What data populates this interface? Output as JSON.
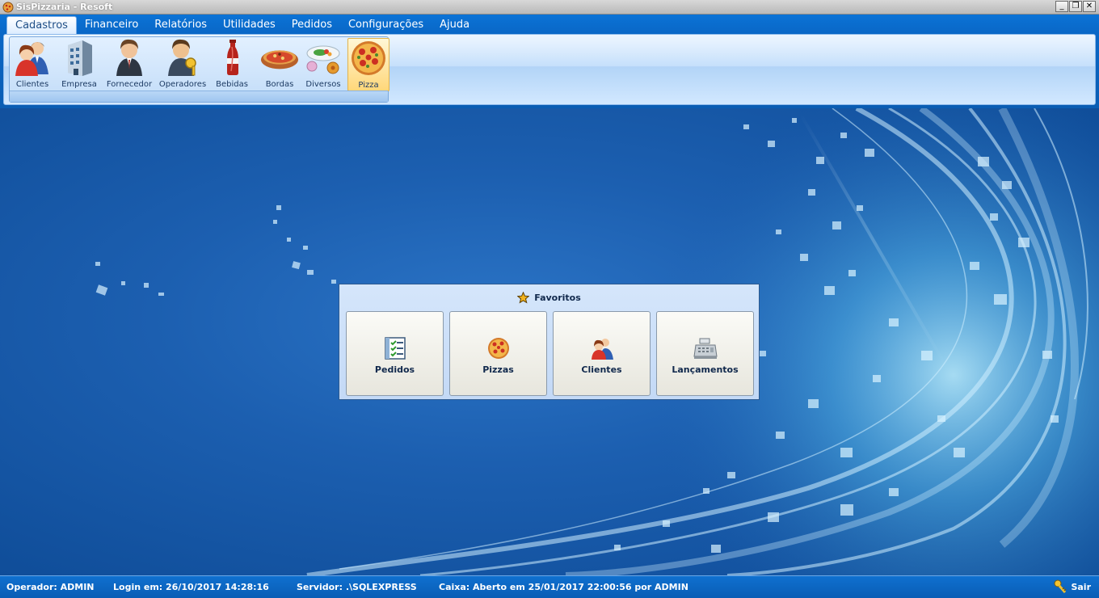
{
  "window": {
    "title": "SisPizzaria - Resoft",
    "minimize_glyph": "_",
    "restore_glyph": "❐",
    "close_glyph": "✕"
  },
  "menu": {
    "tabs": [
      "Cadastros",
      "Financeiro",
      "Relatórios",
      "Utilidades",
      "Pedidos",
      "Configurações",
      "Ajuda"
    ],
    "active_tab": "Cadastros"
  },
  "ribbon": {
    "buttons": [
      {
        "label": "Clientes",
        "icon": "customers-icon"
      },
      {
        "label": "Empresa",
        "icon": "building-icon"
      },
      {
        "label": "Fornecedor",
        "icon": "supplier-icon"
      },
      {
        "label": "Operadores",
        "icon": "operator-key-icon"
      },
      {
        "label": "Bebidas",
        "icon": "soda-bottle-icon"
      },
      {
        "label": "Bordas",
        "icon": "pizza-crust-icon"
      },
      {
        "label": "Diversos",
        "icon": "food-plate-icon"
      },
      {
        "label": "Pizza",
        "icon": "pizza-icon"
      }
    ],
    "selected_button": "Pizza"
  },
  "favorites": {
    "title": "Favoritos",
    "buttons": [
      {
        "label": "Pedidos",
        "icon": "checklist-icon"
      },
      {
        "label": "Pizzas",
        "icon": "pizza-icon"
      },
      {
        "label": "Clientes",
        "icon": "customers-icon"
      },
      {
        "label": "Lançamentos",
        "icon": "cash-register-icon"
      }
    ]
  },
  "status": {
    "operador": "Operador: ADMIN",
    "login": "Login em: 26/10/2017 14:28:16",
    "servidor": "Servidor: .\\SQLEXPRESS",
    "caixa": "Caixa: Aberto em 25/01/2017 22:00:56 por ADMIN",
    "sair": "Sair"
  },
  "colors": {
    "accent": "#0a67c6",
    "ribbon_background": "#c6e0fb",
    "desktop_background": "#1c5fb0",
    "selected_button": "#ffd77a"
  }
}
